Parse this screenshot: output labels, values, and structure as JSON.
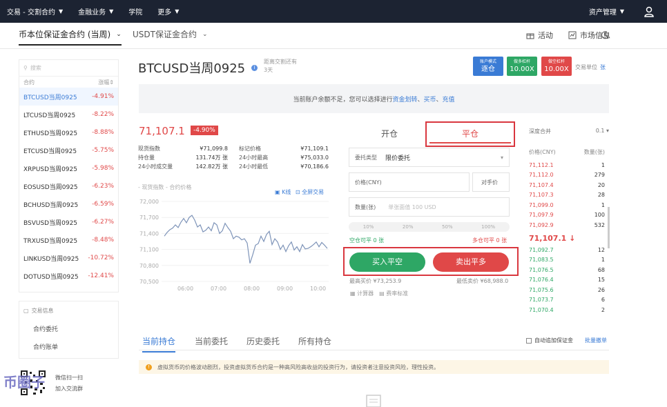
{
  "topnav": {
    "items": [
      "交易 - 交割合约",
      "金融业务",
      "学院",
      "更多"
    ],
    "right_label": "资产管理"
  },
  "subnav": {
    "tab_active": "币本位保证金合约 (当周)",
    "tab_other": "USDT保证金合约",
    "activity": "活动",
    "market": "市场信息"
  },
  "sidebar": {
    "search_placeholder": "搜索",
    "col_contract": "合约",
    "col_change": "涨幅",
    "markets": [
      {
        "name": "BTCUSD当周0925",
        "change": "-4.91%"
      },
      {
        "name": "LTCUSD当周0925",
        "change": "-8.22%"
      },
      {
        "name": "ETHUSD当周0925",
        "change": "-8.88%"
      },
      {
        "name": "ETCUSD当周0925",
        "change": "-5.75%"
      },
      {
        "name": "XRPUSD当周0925",
        "change": "-5.98%"
      },
      {
        "name": "EOSUSD当周0925",
        "change": "-6.23%"
      },
      {
        "name": "BCHUSD当周0925",
        "change": "-6.59%"
      },
      {
        "name": "BSVUSD当周0925",
        "change": "-6.27%"
      },
      {
        "name": "TRXUSD当周0925",
        "change": "-8.48%"
      },
      {
        "name": "LINKUSD当周0925",
        "change": "-10.72%"
      },
      {
        "name": "DOTUSD当周0925",
        "change": "-12.41%"
      }
    ]
  },
  "infobox": {
    "title": "交易信息",
    "link1": "合约委托",
    "link2": "合约账单"
  },
  "contract": {
    "title": "BTCUSD当周0925",
    "settle_line1": "距离交割还有",
    "settle_line2": "3天",
    "mode_label": "账户模式",
    "mode_value": "逐仓",
    "long_label": "做多杠杆",
    "long_value": "10.00X",
    "short_label": "做空杠杆",
    "short_value": "10.00X",
    "unit_label": "交易单位",
    "unit_value": "张"
  },
  "notice": {
    "text": "当前账户余额不足，您可以选择进行",
    "link1": "资金划转",
    "sep1": "、",
    "link2": "买币",
    "sep2": "、",
    "link3": "充值"
  },
  "ticker": {
    "price": "71,107.1",
    "change": "-4.90%",
    "stats": [
      {
        "k": "现货指数",
        "v": "¥71,099.8",
        "k2": "标记价格",
        "v2": "¥71,109.1"
      },
      {
        "k": "持仓量",
        "v": "131.74万 张",
        "k2": "24小时最高",
        "v2": "¥75,033.0"
      },
      {
        "k": "24小时成交量",
        "v": "142.82万 张",
        "k2": "24小时最低",
        "v2": "¥70,186.6"
      }
    ]
  },
  "chart_legend": {
    "spot": "现货指数",
    "contract": "合约价格",
    "kline": "K线",
    "fullscreen": "全屏交易"
  },
  "chart_data": {
    "type": "line",
    "x_ticks": [
      "06:00",
      "07:00",
      "08:00",
      "09:00",
      "10:00"
    ],
    "y_ticks": [
      "72,000",
      "71,700",
      "71,400",
      "71,100",
      "70,800",
      "70,500"
    ],
    "ylim": [
      70500,
      72000
    ],
    "series": [
      {
        "values": [
          71350,
          71420,
          71470,
          71500,
          71560,
          71510,
          71610,
          71680,
          71600,
          71700,
          71740,
          71650,
          71520,
          71560,
          71430,
          71460,
          71520,
          71450,
          71600,
          71560,
          71400,
          71450,
          71590,
          71510,
          71440,
          71300,
          71350,
          71330,
          71280,
          71300,
          71220,
          70840,
          71000,
          71180,
          71210,
          71350,
          71250,
          71380,
          71440,
          71190,
          71300,
          71240,
          71100,
          71180,
          71060,
          71170,
          71240,
          71090,
          71150,
          71060,
          71190,
          71110,
          71120,
          71150,
          71190,
          71240,
          71150,
          71230,
          71180,
          71120
        ]
      }
    ]
  },
  "order_tabs": {
    "open": "开仓",
    "close": "平仓"
  },
  "order_form": {
    "type_label": "委托类型",
    "type_value": "限价委托",
    "price_label": "价格(CNY)",
    "counter_price": "对手价",
    "qty_label": "数量(张)",
    "qty_placeholder": "单张面值 100 USD",
    "pcts": [
      "10%",
      "20%",
      "50%",
      "100%"
    ],
    "long_avail": "空仓可平 0 张",
    "short_avail": "多仓可平 0 张",
    "buy_btn": "买入平空",
    "sell_btn": "卖出平多",
    "max_buy": "最高买价 ¥73,253.9",
    "min_sell": "最低卖价 ¥68,988.0",
    "calc": "计算器",
    "fee": "费率标准"
  },
  "orderbook": {
    "depth_label": "深度合并",
    "depth_value": "0.1",
    "col_price": "价格(CNY)",
    "col_qty": "数量(张)",
    "asks": [
      {
        "p": "71,112.1",
        "q": "1"
      },
      {
        "p": "71,112.0",
        "q": "279"
      },
      {
        "p": "71,107.4",
        "q": "20"
      },
      {
        "p": "71,107.3",
        "q": "28"
      },
      {
        "p": "71,099.0",
        "q": "1"
      },
      {
        "p": "71,097.9",
        "q": "100"
      },
      {
        "p": "71,092.9",
        "q": "532"
      }
    ],
    "mid": "71,107.1 ↓",
    "bids": [
      {
        "p": "71,092.7",
        "q": "12"
      },
      {
        "p": "71,083.5",
        "q": "1"
      },
      {
        "p": "71,076.5",
        "q": "68"
      },
      {
        "p": "71,076.4",
        "q": "15"
      },
      {
        "p": "71,075.6",
        "q": "26"
      },
      {
        "p": "71,073.7",
        "q": "6"
      },
      {
        "p": "71,070.4",
        "q": "2"
      }
    ]
  },
  "bottom_tabs": [
    "当前持仓",
    "当前委托",
    "历史委托",
    "所有持仓"
  ],
  "auto_margin": "自动追加保证金",
  "batch_cancel": "批量撤单",
  "warning": "虚拟货币的价格波动剧烈，投资虚拟货币合约是一种高风险高收益的投资行为，请投资者注意投资风险，理性投资。",
  "qr": {
    "text1": "微信扫一扫",
    "text2": "加入交流群"
  },
  "watermark": "币圈子"
}
